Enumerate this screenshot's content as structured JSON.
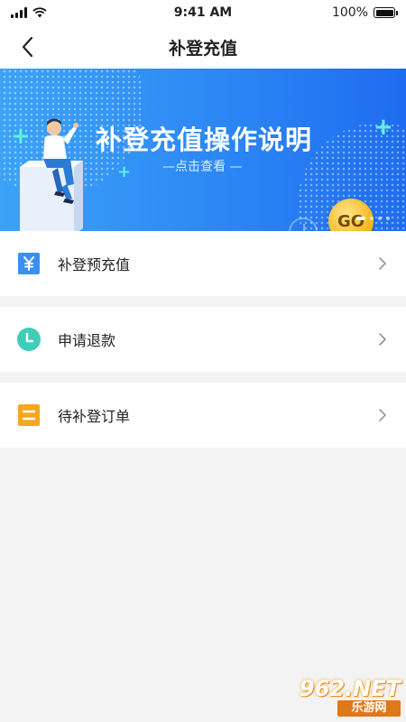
{
  "status_bar": {
    "time": "9:41 AM",
    "battery": "100%",
    "battery_level": 1.0
  },
  "nav": {
    "title": "补登充值"
  },
  "banner": {
    "title": "补登充值操作说明",
    "subtitle": "—点击查看 —",
    "go_label": "GO",
    "page_count": 4,
    "active_page": 1
  },
  "menu": [
    {
      "label": "补登预充值",
      "icon": "yen-card-icon",
      "color": "#3b8ff0"
    },
    {
      "label": "申请退款",
      "icon": "clock-circle-icon",
      "color": "#3ecdb8"
    },
    {
      "label": "待补登订单",
      "icon": "pending-list-icon",
      "color": "#f5a623"
    }
  ],
  "watermark": {
    "top": "962.NET",
    "bottom": "乐游网"
  }
}
